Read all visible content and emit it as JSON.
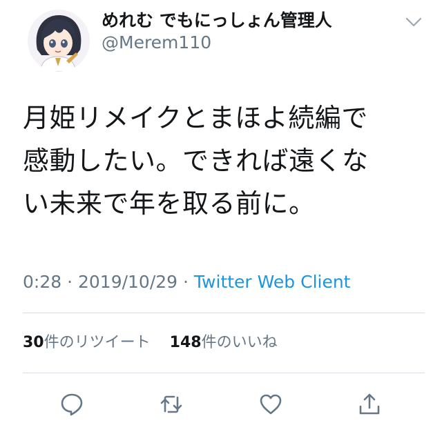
{
  "author": {
    "display_name": "めれむ でもにっしょん管理人",
    "handle": "@Merem110",
    "avatar_icon": "avatar-illustration-icon"
  },
  "tweet": {
    "lines": [
      "月姫リメイクとまほよ続編で",
      "感動したい。できれば遠くな",
      "い未来で年を取る前に。"
    ]
  },
  "meta": {
    "time": "0:28",
    "separator": " · ",
    "date": "2019/10/29",
    "client": "Twitter Web Client"
  },
  "stats": {
    "retweets_count": "30",
    "retweets_label": "件のリツイート",
    "likes_count": "148",
    "likes_label": "件のいいね"
  },
  "actions": [
    {
      "name": "reply",
      "icon": "reply-icon"
    },
    {
      "name": "retweet",
      "icon": "retweet-icon"
    },
    {
      "name": "like",
      "icon": "heart-icon"
    },
    {
      "name": "share",
      "icon": "share-icon"
    }
  ],
  "colors": {
    "text": "#14171a",
    "secondary": "#657786",
    "link": "#1b95e0",
    "divider": "#d8dee3"
  }
}
